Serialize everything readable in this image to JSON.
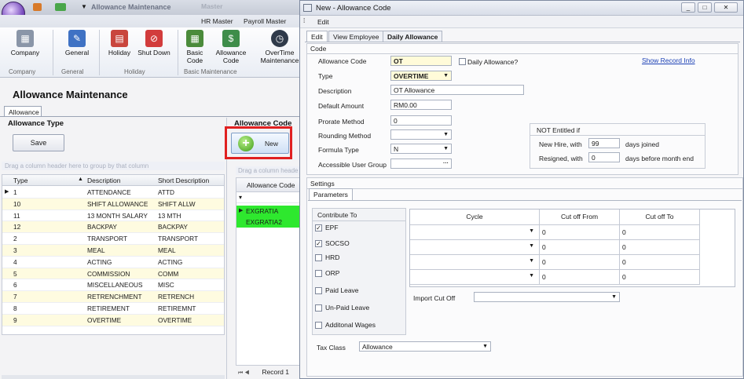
{
  "back_window": {
    "title": "Allowance Maintenance",
    "ribbon_tabs": [
      "Master",
      "HR Master",
      "Payroll Master"
    ],
    "ribbon_buttons": [
      {
        "label": "Company",
        "icon": "building-icon"
      },
      {
        "label": "General",
        "icon": "tools-icon"
      },
      {
        "label": "Holiday",
        "icon": "calendar-icon"
      },
      {
        "label": "Shut Down",
        "icon": "no-entry-icon"
      },
      {
        "label": "Basic Code",
        "icon": "grid-icon"
      },
      {
        "label": "Allowance Code",
        "icon": "money-icon"
      },
      {
        "label": "OverTime Maintenance",
        "icon": "clock-icon"
      }
    ],
    "ribbon_groups": [
      "Company",
      "General",
      "Holiday",
      "Basic Maintenance"
    ],
    "page_title": "Allowance Maintenance",
    "subtab": "Allowance",
    "left_section": "Allowance Type",
    "right_section": "Allowance Code",
    "save_label": "Save",
    "new_label": "New",
    "drag_hint": "Drag a column header here to group by that column",
    "drag_hint_short": "Drag a column heade",
    "grid_columns": [
      "Type",
      "Description",
      "Short Description"
    ],
    "grid_rows": [
      [
        "1",
        "ATTENDANCE",
        "ATTD"
      ],
      [
        "10",
        "SHIFT ALLOWANCE",
        "SHIFT ALLW"
      ],
      [
        "11",
        "13 MONTH SALARY",
        "13 MTH"
      ],
      [
        "12",
        "BACKPAY",
        "BACKPAY"
      ],
      [
        "2",
        "TRANSPORT",
        "TRANSPORT"
      ],
      [
        "3",
        "MEAL",
        "MEAL"
      ],
      [
        "4",
        "ACTING",
        "ACTING"
      ],
      [
        "5",
        "COMMISSION",
        "COMM"
      ],
      [
        "6",
        "MISCELLANEOUS",
        "MISC"
      ],
      [
        "7",
        "RETRENCHMENT",
        "RETRENCH"
      ],
      [
        "8",
        "RETIREMENT",
        "RETIREMNT"
      ],
      [
        "9",
        "OVERTIME",
        "OVERTIME"
      ]
    ],
    "code_column": "Allowance Code",
    "code_rows": [
      "EXGRATIA",
      "EXGRATIA2"
    ],
    "record_label": "Record 1"
  },
  "dialog": {
    "title": "New - Allowance Code",
    "menu": "Edit",
    "tabs": [
      "Edit",
      "View Employee",
      "Daily Allowance"
    ],
    "code_section": "Code",
    "fields": {
      "allowance_code_label": "Allowance Code",
      "allowance_code": "OT",
      "daily_allowance_label": "Daily Allowance?",
      "show_record_info": "Show Record Info",
      "type_label": "Type",
      "type": "OVERTIME",
      "description_label": "Description",
      "description": "OT Allowance",
      "default_amount_label": "Default Amount",
      "default_amount": "RM0.00",
      "prorate_label": "Prorate Method",
      "prorate": "0",
      "rounding_label": "Rounding Method",
      "rounding": "",
      "formula_label": "Formula Type",
      "formula": "N",
      "user_group_label": "Accessible User Group",
      "user_group": ""
    },
    "not_entitled": {
      "title": "NOT Entitled if",
      "new_hire_label": "New Hire, with",
      "new_hire_value": "99",
      "new_hire_suffix": "days joined",
      "resigned_label": "Resigned, with",
      "resigned_value": "0",
      "resigned_suffix": "days before month end"
    },
    "settings_section": "Settings",
    "parameters_tab": "Parameters",
    "contribute_to": {
      "title": "Contribute To",
      "items": [
        {
          "label": "EPF",
          "checked": true
        },
        {
          "label": "SOCSO",
          "checked": true
        },
        {
          "label": "HRD",
          "checked": false
        },
        {
          "label": "ORP",
          "checked": false
        },
        {
          "label": "Paid Leave",
          "checked": false
        },
        {
          "label": "Un-Paid Leave",
          "checked": false
        },
        {
          "label": "Additonal Wages",
          "checked": false
        }
      ]
    },
    "cycle_grid": {
      "columns": [
        "Cycle",
        "Cut off From",
        "Cut off To"
      ],
      "rows": [
        [
          "",
          "0",
          "0"
        ],
        [
          "",
          "0",
          "0"
        ],
        [
          "",
          "0",
          "0"
        ],
        [
          "",
          "0",
          "0"
        ]
      ]
    },
    "import_cutoff_label": "Import Cut Off",
    "import_cutoff": "",
    "tax_class_label": "Tax Class",
    "tax_class": "Allowance"
  }
}
